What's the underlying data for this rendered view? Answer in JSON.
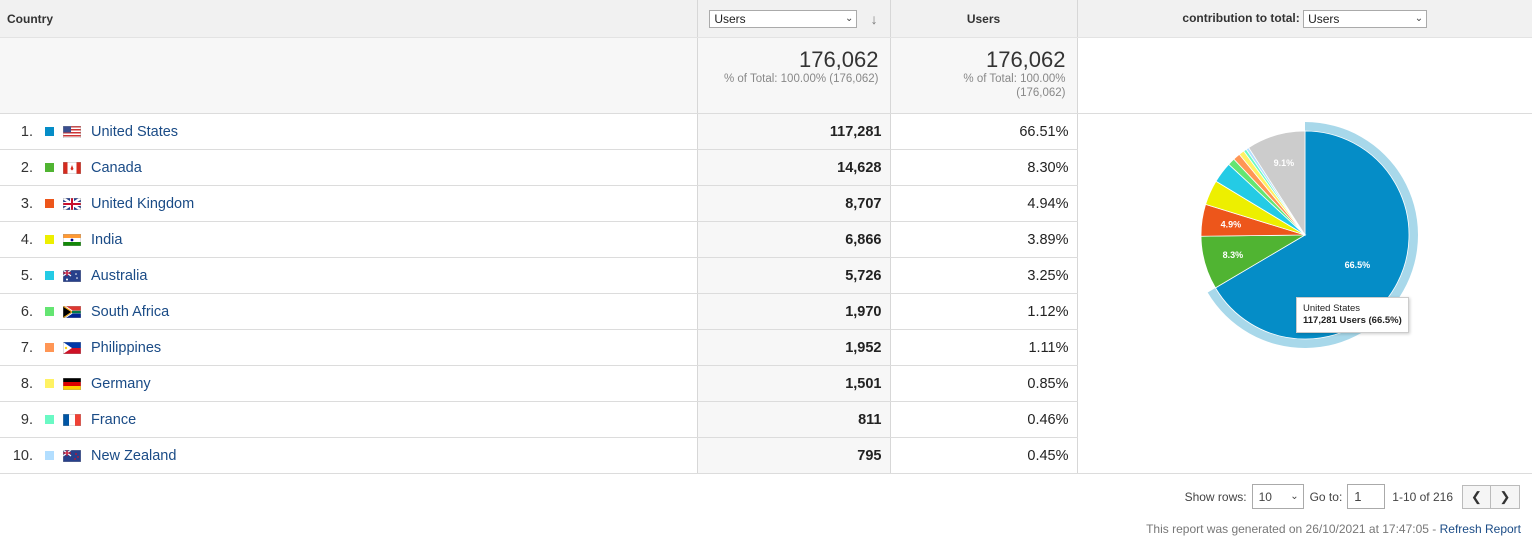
{
  "header": {
    "country_label": "Country",
    "primary_select": "Users",
    "col2_label": "Users",
    "contribution_label": "contribution to total:",
    "contribution_select": "Users"
  },
  "totals": {
    "primary_value": "176,062",
    "primary_pct": "% of Total: 100.00% (176,062)",
    "second_value": "176,062",
    "second_pct_line1": "% of Total: 100.00%",
    "second_pct_line2": "(176,062)"
  },
  "rows": [
    {
      "rank": "1.",
      "country": "United States",
      "users": "117,281",
      "pct": "66.51%",
      "color": "#058dc7",
      "flag": "us"
    },
    {
      "rank": "2.",
      "country": "Canada",
      "users": "14,628",
      "pct": "8.30%",
      "color": "#50b432",
      "flag": "ca"
    },
    {
      "rank": "3.",
      "country": "United Kingdom",
      "users": "8,707",
      "pct": "4.94%",
      "color": "#ed561b",
      "flag": "gb"
    },
    {
      "rank": "4.",
      "country": "India",
      "users": "6,866",
      "pct": "3.89%",
      "color": "#edef00",
      "flag": "in"
    },
    {
      "rank": "5.",
      "country": "Australia",
      "users": "5,726",
      "pct": "3.25%",
      "color": "#24cbe5",
      "flag": "au"
    },
    {
      "rank": "6.",
      "country": "South Africa",
      "users": "1,970",
      "pct": "1.12%",
      "color": "#64e572",
      "flag": "za"
    },
    {
      "rank": "7.",
      "country": "Philippines",
      "users": "1,952",
      "pct": "1.11%",
      "color": "#ff9655",
      "flag": "ph"
    },
    {
      "rank": "8.",
      "country": "Germany",
      "users": "1,501",
      "pct": "0.85%",
      "color": "#fff263",
      "flag": "de"
    },
    {
      "rank": "9.",
      "country": "France",
      "users": "811",
      "pct": "0.46%",
      "color": "#6af9c4",
      "flag": "fr"
    },
    {
      "rank": "10.",
      "country": "New Zealand",
      "users": "795",
      "pct": "0.45%",
      "color": "#b2deff",
      "flag": "nz"
    }
  ],
  "chart_data": {
    "type": "pie",
    "slices": [
      {
        "label": "United States",
        "value": 66.51,
        "color": "#058dc7",
        "data_label": "66.5%"
      },
      {
        "label": "Canada",
        "value": 8.3,
        "color": "#50b432",
        "data_label": "8.3%"
      },
      {
        "label": "United Kingdom",
        "value": 4.94,
        "color": "#ed561b",
        "data_label": "4.9%"
      },
      {
        "label": "India",
        "value": 3.89,
        "color": "#edef00",
        "data_label": ""
      },
      {
        "label": "Australia",
        "value": 3.25,
        "color": "#24cbe5",
        "data_label": ""
      },
      {
        "label": "South Africa",
        "value": 1.12,
        "color": "#64e572",
        "data_label": ""
      },
      {
        "label": "Philippines",
        "value": 1.11,
        "color": "#ff9655",
        "data_label": ""
      },
      {
        "label": "Germany",
        "value": 0.85,
        "color": "#fff263",
        "data_label": ""
      },
      {
        "label": "France",
        "value": 0.46,
        "color": "#6af9c4",
        "data_label": ""
      },
      {
        "label": "New Zealand",
        "value": 0.45,
        "color": "#b2deff",
        "data_label": ""
      },
      {
        "label": "Other",
        "value": 9.12,
        "color": "#cccccc",
        "data_label": "9.1%"
      }
    ],
    "highlighted": "United States",
    "tooltip_line1": "United States",
    "tooltip_line2": "117,281 Users (66.5%)"
  },
  "footer": {
    "show_rows_label": "Show rows:",
    "show_rows_value": "10",
    "goto_label": "Go to:",
    "goto_value": "1",
    "range": "1-10 of 216",
    "generated": "This report was generated on 26/10/2021 at 17:47:05 - ",
    "refresh": "Refresh Report"
  }
}
